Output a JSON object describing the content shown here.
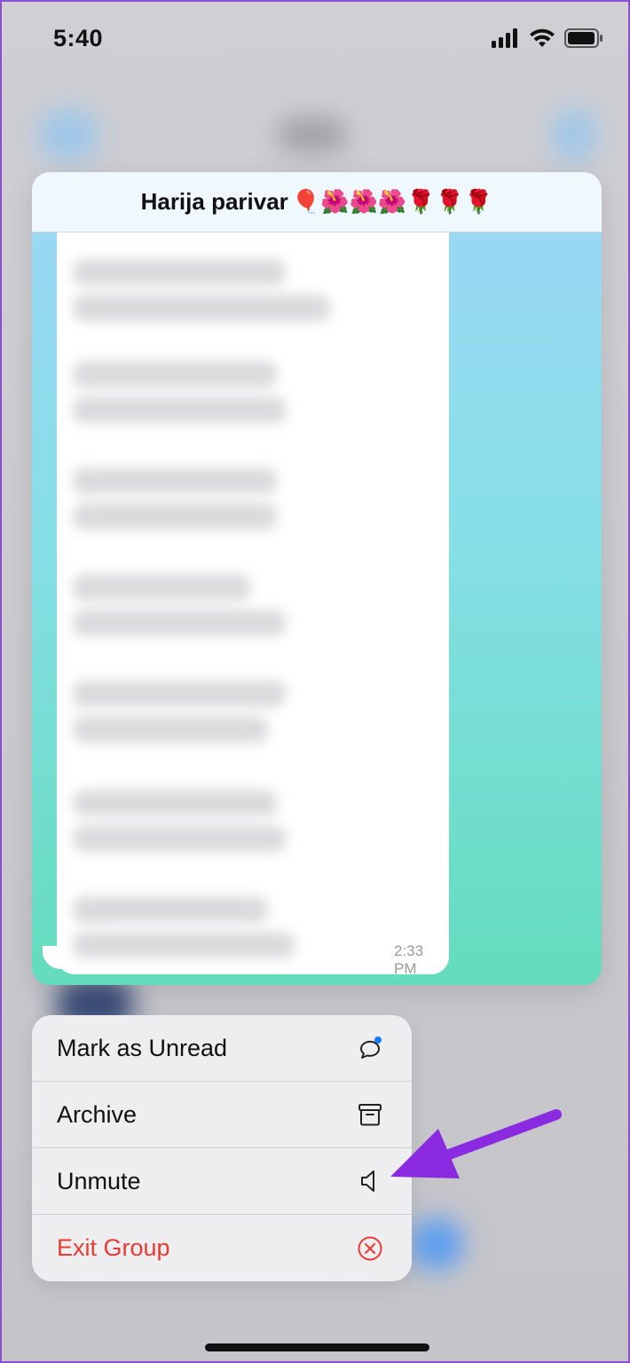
{
  "status_bar": {
    "time": "5:40",
    "icons": [
      "signal-icon",
      "wifi-icon",
      "battery-icon"
    ]
  },
  "preview": {
    "chat_title": "Harija parivar",
    "title_emoji": "🎈🌺🌺🌺🌹🌹🌹",
    "message_time": "2:33 PM"
  },
  "context_menu": {
    "items": [
      {
        "label": "Mark as Unread",
        "icon": "unread-bubble-icon",
        "style": "normal"
      },
      {
        "label": "Archive",
        "icon": "archive-box-icon",
        "style": "normal"
      },
      {
        "label": "Unmute",
        "icon": "speaker-icon",
        "style": "normal"
      },
      {
        "label": "Exit Group",
        "icon": "circle-x-icon",
        "style": "destructive"
      }
    ]
  },
  "colors": {
    "accent_annotation": "#8a2be2",
    "destructive": "#ea3a30",
    "unread_dot": "#1a7cf5"
  }
}
